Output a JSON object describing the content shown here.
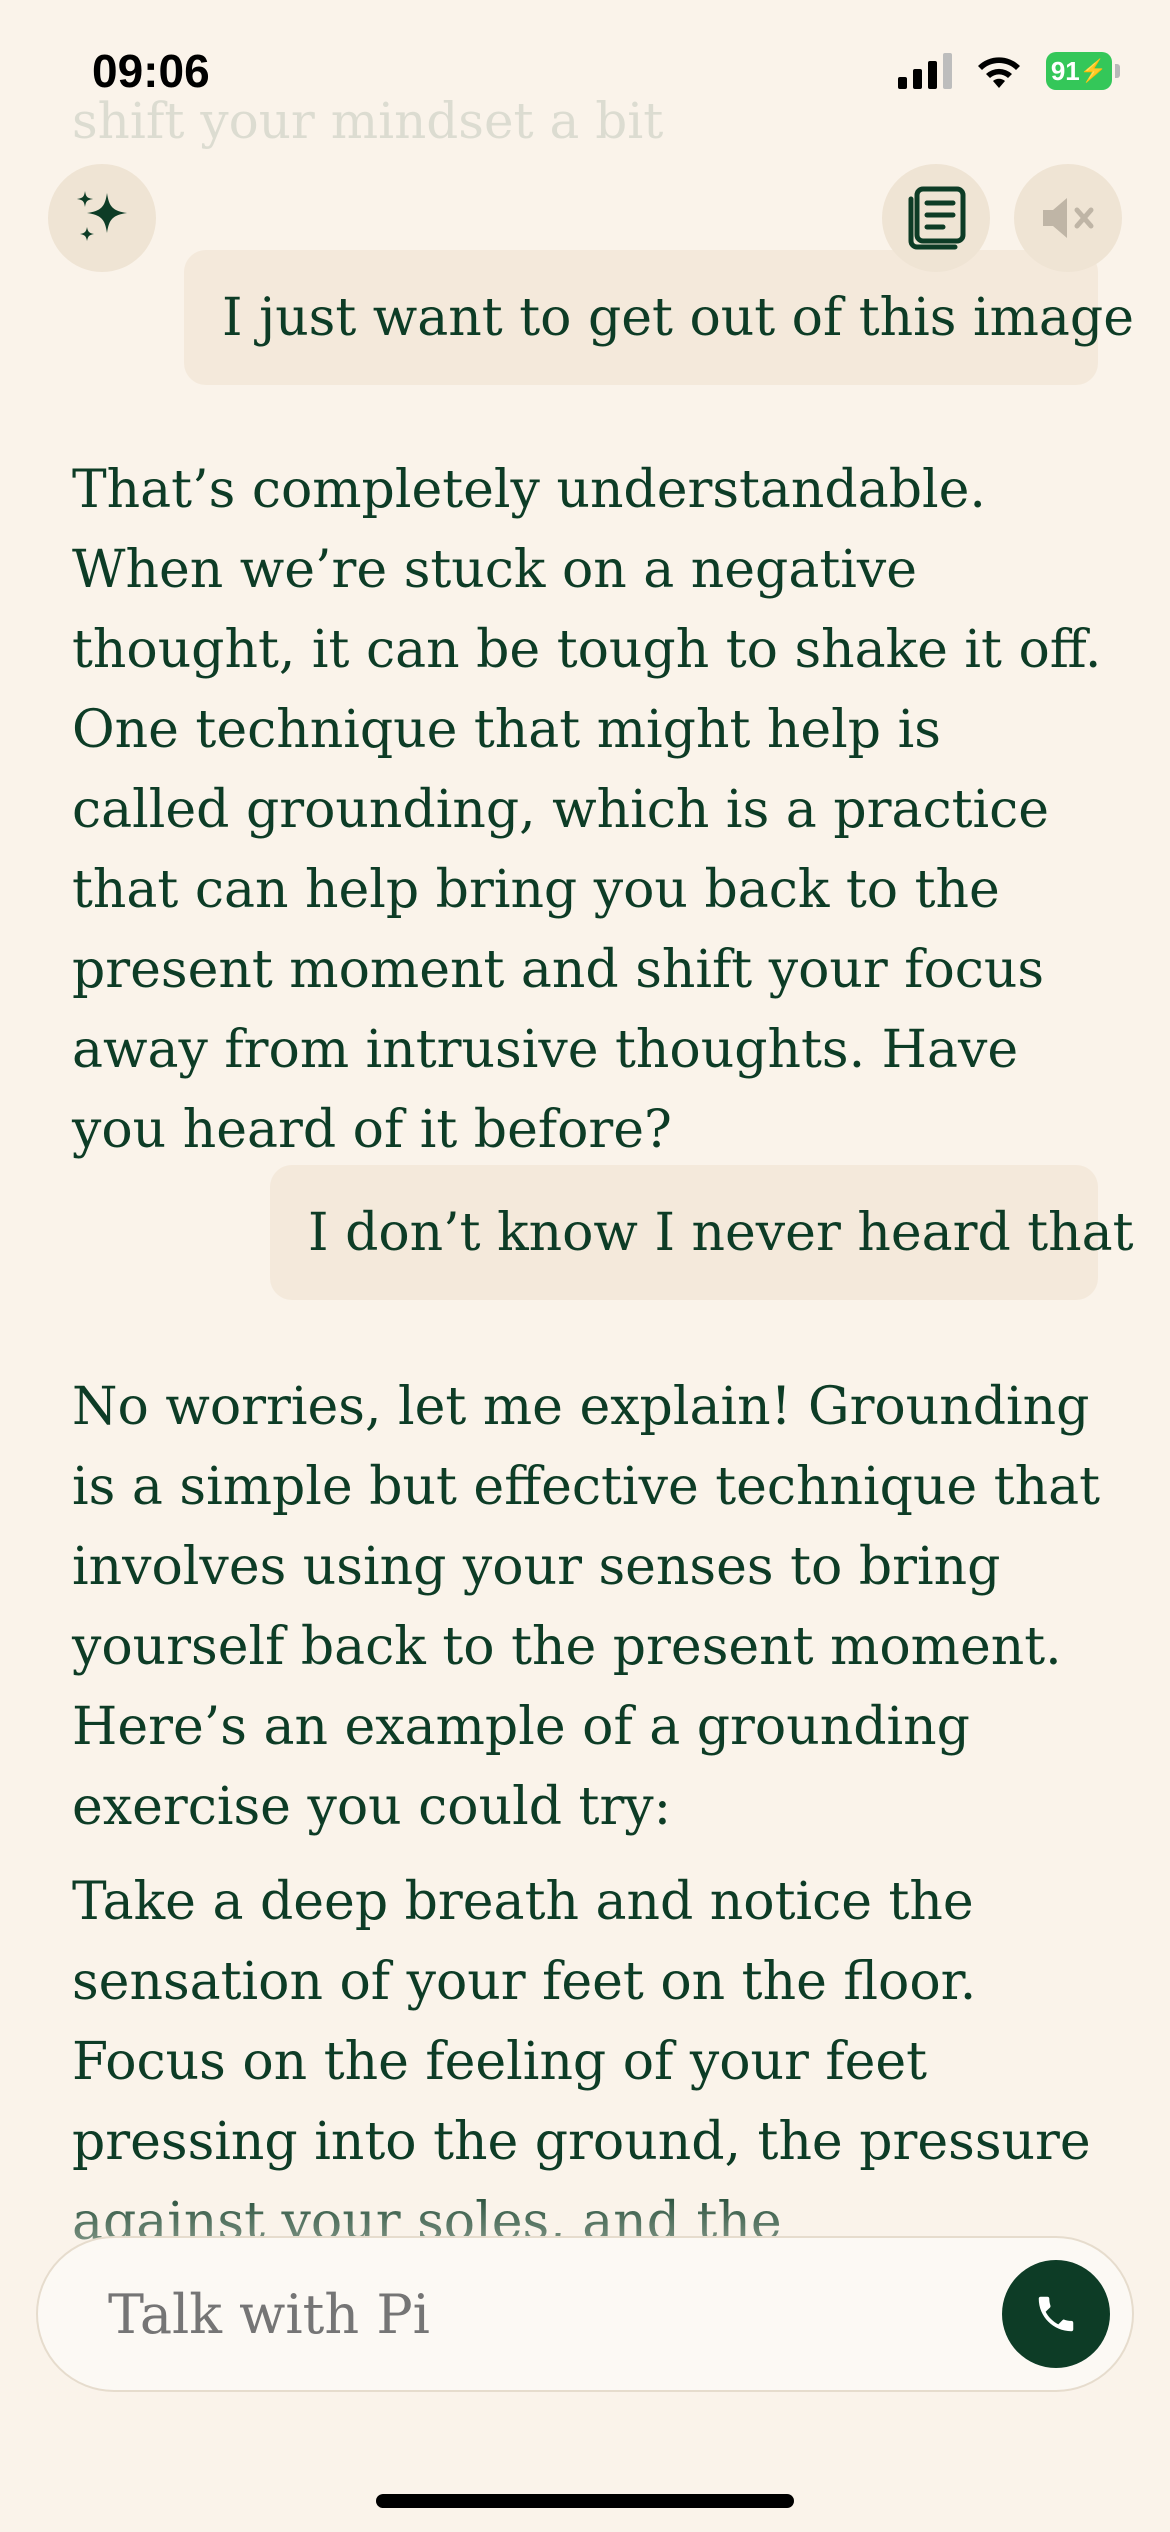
{
  "status_bar": {
    "time": "09:06",
    "battery": "91"
  },
  "faded_top_text": "shift your mindset a bit",
  "icons": {
    "sparkle": "sparkle-icon",
    "news": "news-icon",
    "mute": "speaker-mute-icon",
    "call": "phone-icon"
  },
  "messages": [
    {
      "role": "user",
      "text": "I just want to get out of this image"
    },
    {
      "role": "pi",
      "text": "That’s completely understandable. When we’re stuck on a negative thought, it can be tough to shake it off. One technique that might help is called grounding, which is a practice that can help bring you back to the present moment and shift your focus away from intrusive thoughts. Have you heard of it before?"
    },
    {
      "role": "user",
      "text": "I don’t know I never heard that"
    },
    {
      "role": "pi",
      "text": "No worries, let me explain! Grounding is a simple but effective technique that involves using your senses to bring yourself back to the present moment. Here’s an example of a grounding exercise you could try:"
    },
    {
      "role": "pi",
      "text": "Take a deep breath and notice the sensation of your feet on the floor. Focus on the feeling of your feet pressing into the ground, the pressure against your soles, and the temperature of the floor."
    }
  ],
  "input": {
    "placeholder": "Talk with Pi"
  },
  "colors": {
    "background": "#faf3ea",
    "text": "#0d3c26",
    "user_bubble": "#f4e9db",
    "call_button": "#0d3c26",
    "battery": "#34c759"
  }
}
